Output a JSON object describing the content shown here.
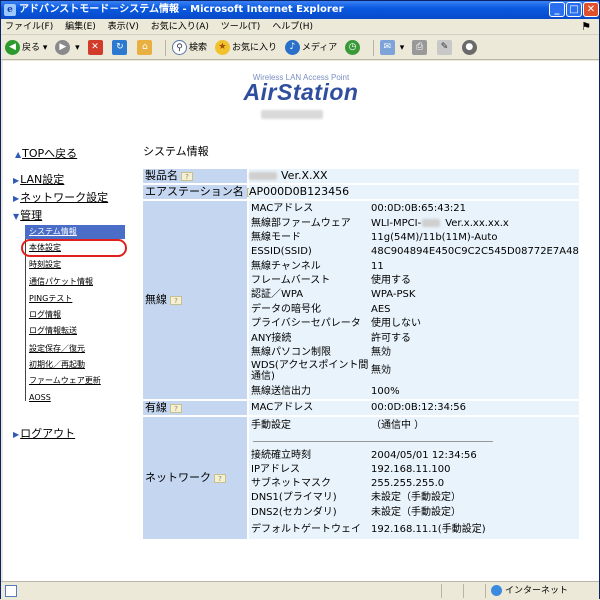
{
  "window": {
    "title": "アドバンストモード－システム情報 - Microsoft Internet Explorer",
    "controls": {
      "minimize": "_",
      "maximize": "□",
      "close": "✕"
    }
  },
  "menu": {
    "items": [
      "ファイル(F)",
      "編集(E)",
      "表示(V)",
      "お気に入り(A)",
      "ツール(T)",
      "ヘルプ(H)"
    ]
  },
  "toolbar": {
    "back": "戻る",
    "search": "検索",
    "favorites": "お気に入り",
    "media": "メディア"
  },
  "logo": {
    "subtitle": "Wireless LAN Access Point",
    "brand": "AirStation"
  },
  "nav": {
    "top": "TOPへ戻る",
    "lan": "LAN設定",
    "network": "ネットワーク設定",
    "admin": "管理",
    "logout": "ログアウト",
    "sub_items": [
      "システム情報",
      "本体設定",
      "時刻設定",
      "通信パケット情報",
      "PINGテスト",
      "ログ情報",
      "ログ情報転送",
      "設定保存／復元",
      "初期化／再起動",
      "ファームウェア更新",
      "AOSS"
    ]
  },
  "page": {
    "section_title": "システム情報",
    "product_label": "製品名",
    "product_version": "Ver.X.XX",
    "airstation_name_label": "エアステーション名",
    "airstation_name": "AP000D0B123456",
    "wireless_label": "無線",
    "wireless": [
      {
        "k": "MACアドレス",
        "v": "00:0D:0B:65:43:21"
      },
      {
        "k": "無線部ファームウェア",
        "v": "WLI-MPCI-",
        "v2": "Ver.x.xx.xx.x"
      },
      {
        "k": "無線モード",
        "v": "11g(54M)/11b(11M)-Auto"
      },
      {
        "k": "ESSID(SSID)",
        "v": "48C904894E450C9C2C545D08772E7A48"
      },
      {
        "k": "無線チャンネル",
        "v": "11"
      },
      {
        "k": "フレームバースト",
        "v": "使用する"
      },
      {
        "k": "認証／WPA",
        "v": "WPA-PSK"
      },
      {
        "k": "データの暗号化",
        "v": "AES"
      },
      {
        "k": "プライバシーセパレータ",
        "v": "使用しない"
      },
      {
        "k": "ANY接続",
        "v": "許可する"
      },
      {
        "k": "無線パソコン制限",
        "v": "無効"
      },
      {
        "k": "WDS(アクセスポイント間通信)",
        "v": "無効"
      },
      {
        "k": "無線送信出力",
        "v": "100%"
      }
    ],
    "wired_label": "有線",
    "wired_mac_label": "MACアドレス",
    "wired_mac": "00:0D:0B:12:34:56",
    "network_label": "ネットワーク",
    "network_mode_label": "手動設定",
    "network_mode_value": "（通信中 ）",
    "network": [
      {
        "k": "接続確立時刻",
        "v": "2004/05/01 12:34:56"
      },
      {
        "k": "IPアドレス",
        "v": "192.168.11.100"
      },
      {
        "k": "サブネットマスク",
        "v": "255.255.255.0"
      },
      {
        "k": "DNS1(プライマリ)",
        "v": "未設定（手動設定）"
      },
      {
        "k": "DNS2(セカンダリ)",
        "v": "未設定（手動設定）"
      },
      {
        "k": "デフォルトゲートウェイ",
        "v": "192.168.11.1(手動設定)"
      }
    ]
  },
  "status": {
    "zone": "インターネット"
  },
  "icons": [
    "ie-icon",
    "back-icon",
    "forward-icon",
    "stop-icon",
    "refresh-icon",
    "home-icon",
    "search-icon",
    "favorites-icon",
    "media-icon",
    "history-icon",
    "mail-icon",
    "print-icon",
    "edit-icon",
    "messenger-icon",
    "help-icon",
    "globe-icon"
  ]
}
